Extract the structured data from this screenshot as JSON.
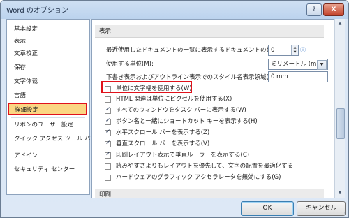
{
  "window": {
    "title": "Word のオプション",
    "help_label": "?",
    "close_label": "X"
  },
  "sidebar": {
    "items": [
      {
        "label": "基本設定"
      },
      {
        "label": "表示"
      },
      {
        "label": "文章校正"
      },
      {
        "label": "保存"
      },
      {
        "label": "文字体裁"
      },
      {
        "label": "言語"
      },
      {
        "label": "詳細設定",
        "selected": true
      },
      {
        "label": "リボンのユーザー設定"
      },
      {
        "label": "クイック アクセス ツール バー"
      },
      {
        "label": "アドイン"
      },
      {
        "label": "セキュリティ センター"
      }
    ]
  },
  "main": {
    "section_display": "表示",
    "recent_docs_label": "最近使用したドキュメントの一覧に表示するドキュメントの数(R):",
    "recent_docs_value": "0",
    "units_label": "使用する単位(M):",
    "units_value": "ミリメートル (mm)",
    "style_width_label": "下書き表示およびアウトライン表示でのスタイル名表示領域(E):",
    "style_width_value": "0 mm",
    "checkboxes": [
      {
        "label": "単位に文字幅を使用する(W)",
        "checked": false
      },
      {
        "label": "HTML 関連は単位にピクセルを使用する(X)",
        "checked": false
      },
      {
        "label": "すべてのウィンドウをタスク バーに表示する(W)",
        "checked": true
      },
      {
        "label": "ボタン名と一緒にショートカット キーを表示する(H)",
        "checked": true
      },
      {
        "label": "水平スクロール バーを表示する(Z)",
        "checked": true
      },
      {
        "label": "垂直スクロール バーを表示する(V)",
        "checked": true
      },
      {
        "label": "印刷レイアウト表示で垂直ルーラーを表示する(C)",
        "checked": true
      },
      {
        "label": "読みやすさよりもレイアウトを優先して、文字の配置を最適化する",
        "checked": false
      },
      {
        "label": "ハードウェアのグラフィック アクセラレータを無効にする(G)",
        "checked": false
      }
    ],
    "section_print": "印刷"
  },
  "footer": {
    "ok_label": "OK",
    "cancel_label": "キャンセル"
  },
  "colors": {
    "highlight_border": "#e0121b",
    "selected_bg": "#fbd683"
  }
}
